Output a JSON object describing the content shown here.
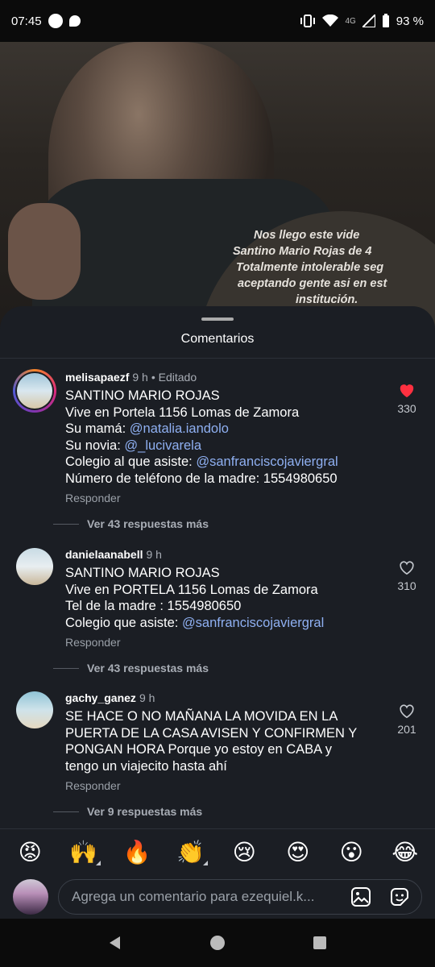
{
  "status_bar": {
    "time": "07:45",
    "network": "4G",
    "battery": "93 %",
    "icons": [
      "notification-dot-icon",
      "chat-bubble-icon",
      "vibrate-icon",
      "wifi-icon",
      "signal-icon",
      "battery-icon"
    ]
  },
  "story": {
    "caption_lines": [
      "Nos llego este vide",
      "Santino Mario Rojas de 4",
      "Totalmente intolerable seg",
      "aceptando gente asi en est",
      "institución."
    ]
  },
  "sheet": {
    "title": "Comentarios"
  },
  "comments": [
    {
      "username": "melisapaezf",
      "time": "9 h",
      "edited": "• Editado",
      "lines": [
        {
          "text": "SANTINO MARIO ROJAS"
        },
        {
          "text": "Vive en Portela 1156 Lomas de Zamora"
        },
        {
          "text": "Su mamá: ",
          "mention": "@natalia.iandolo"
        },
        {
          "text": "Su novia: ",
          "mention": "@_lucivarela"
        },
        {
          "text": "Colegio al que asiste: ",
          "mention": "@sanfranciscojaviergral"
        },
        {
          "text": "Número de teléfono de la madre: 1554980650"
        }
      ],
      "reply_label": "Responder",
      "likes": "330",
      "liked": true,
      "more_replies": "Ver 43 respuestas más"
    },
    {
      "username": "danielaanabell",
      "time": "9 h",
      "edited": "",
      "lines": [
        {
          "text": "SANTINO MARIO ROJAS"
        },
        {
          "text": "Vive en PORTELA 1156 Lomas de Zamora"
        },
        {
          "text": "Tel de la madre : 1554980650"
        },
        {
          "text": "Colegio que asiste: ",
          "mention": "@sanfranciscojaviergral"
        }
      ],
      "reply_label": "Responder",
      "likes": "310",
      "liked": false,
      "more_replies": "Ver 43 respuestas más"
    },
    {
      "username": "gachy_ganez",
      "time": "9 h",
      "edited": "",
      "lines": [
        {
          "text": "SE HACE O NO MAÑANA LA MOVIDA EN LA"
        },
        {
          "text": "PUERTA DE LA CASA AVISEN Y CONFIRMEN Y"
        },
        {
          "text": "PONGAN HORA Porque yo estoy en CABA y"
        },
        {
          "text": "tengo un viajecito hasta ahí"
        }
      ],
      "reply_label": "Responder",
      "likes": "201",
      "liked": false,
      "more_replies": "Ver 9 respuestas más"
    }
  ],
  "emoji_bar": [
    "😡",
    "🙌",
    "🔥",
    "👏",
    "😢",
    "😍",
    "😮",
    "😂"
  ],
  "input": {
    "placeholder": "Agrega un comentario para ezequiel.k..."
  },
  "colors": {
    "sheet_bg": "#1b1e24",
    "mention": "#8fb0f2",
    "like_red": "#ff3040"
  }
}
